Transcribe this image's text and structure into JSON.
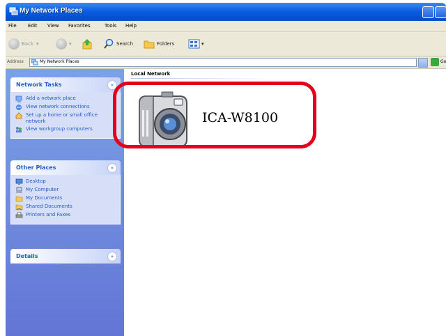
{
  "window": {
    "title": "My Network Places"
  },
  "menu": [
    "File",
    "Edit",
    "View",
    "Favorites",
    "Tools",
    "Help"
  ],
  "toolbar": {
    "back_label": "Back",
    "search_label": "Search",
    "folders_label": "Folders"
  },
  "address": {
    "label": "Address",
    "value": "My Network Places",
    "go_label": "Go"
  },
  "task_panels": {
    "network_tasks": {
      "title": "Network Tasks",
      "items": [
        {
          "label": "Add a network place",
          "icon": "add-network-place-icon"
        },
        {
          "label": "View network connections",
          "icon": "network-connections-icon"
        },
        {
          "label": "Set up a home or small office network",
          "icon": "home-network-icon"
        },
        {
          "label": "View workgroup computers",
          "icon": "workgroup-icon"
        }
      ]
    },
    "other_places": {
      "title": "Other Places",
      "items": [
        {
          "label": "Desktop",
          "icon": "desktop-icon"
        },
        {
          "label": "My Computer",
          "icon": "my-computer-icon"
        },
        {
          "label": "My Documents",
          "icon": "my-documents-icon"
        },
        {
          "label": "Shared Documents",
          "icon": "shared-documents-icon"
        },
        {
          "label": "Printers and Faxes",
          "icon": "printer-icon"
        }
      ]
    },
    "details": {
      "title": "Details"
    }
  },
  "content": {
    "group_label": "Local Network",
    "device": {
      "label": "ICA-W8100",
      "icon": "camera-icon"
    }
  },
  "colors": {
    "highlight": "#e3001b",
    "title_bar": "#0a5fe0",
    "task_link": "#215dc6"
  }
}
